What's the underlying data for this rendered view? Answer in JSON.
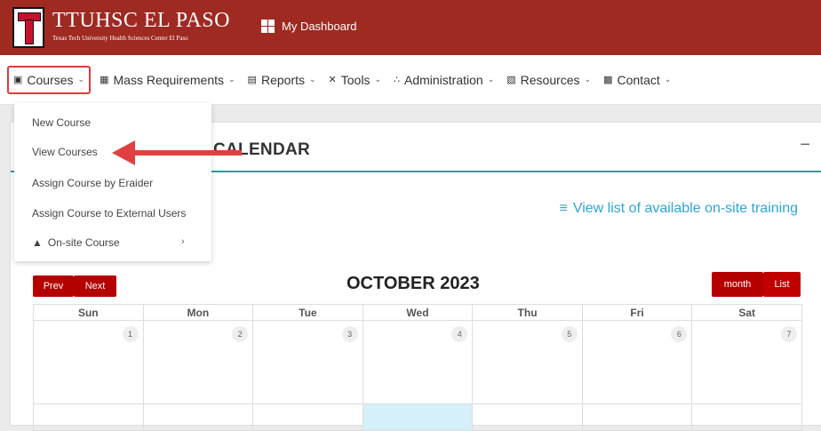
{
  "header": {
    "logo_title": "TTUHSC EL PASO",
    "logo_subtitle": "Texas Tech University Health Sciences Center El Paso",
    "dashboard_label": "My Dashboard"
  },
  "nav": {
    "items": [
      {
        "label": "Courses",
        "icon": "book-icon"
      },
      {
        "label": "Mass Requirements",
        "icon": "calendar-icon"
      },
      {
        "label": "Reports",
        "icon": "presentation-icon"
      },
      {
        "label": "Tools",
        "icon": "tools-icon"
      },
      {
        "label": "Administration",
        "icon": "users-icon"
      },
      {
        "label": "Resources",
        "icon": "open-book-icon"
      },
      {
        "label": "Contact",
        "icon": "contact-card-icon"
      }
    ]
  },
  "dropdown": {
    "items": [
      "New Course",
      "View Courses",
      "Assign Course by Eraider",
      "Assign Course to External Users",
      "On-site Course"
    ]
  },
  "card": {
    "title": "CALENDAR",
    "collapse_label": "−",
    "onsite_link": "View list of available on-site training"
  },
  "calendar": {
    "prev_label": "Prev",
    "next_label": "Next",
    "month_label": "month",
    "list_label": "List",
    "title": "OCTOBER 2023",
    "weekdays": [
      "Sun",
      "Mon",
      "Tue",
      "Wed",
      "Thu",
      "Fri",
      "Sat"
    ],
    "days": [
      "1",
      "2",
      "3",
      "4",
      "5",
      "6",
      "7"
    ]
  },
  "colors": {
    "header_bg": "#9e2a22",
    "accent_red": "#b50000",
    "link_blue": "#2ea5d6",
    "teal_rule": "#2a9d9d",
    "highlight_box": "#e03a3a"
  }
}
